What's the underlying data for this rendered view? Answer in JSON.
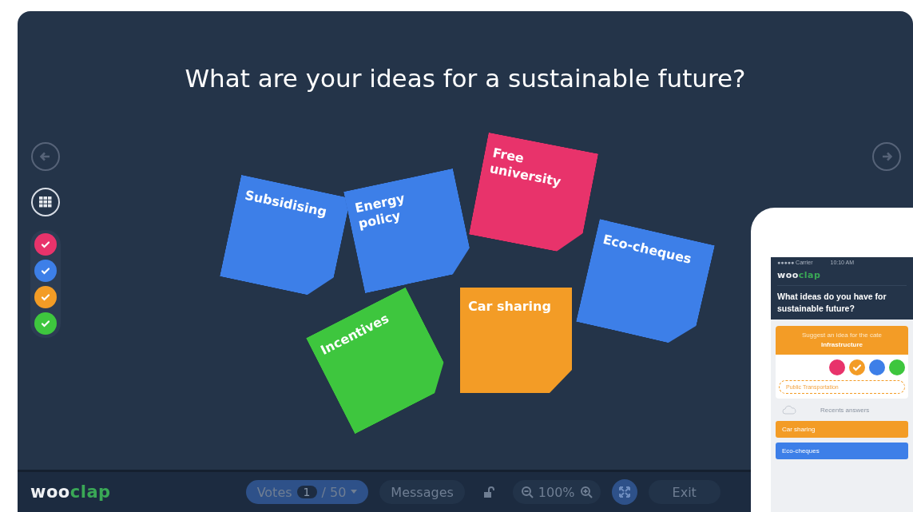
{
  "question": "What are your ideas for a sustainable future?",
  "notes": [
    {
      "text": "Subsidising",
      "color": "#3d7fe8"
    },
    {
      "text": "Energy policy",
      "color": "#3d7fe8"
    },
    {
      "text": "Free university",
      "color": "#e8336b"
    },
    {
      "text": "Eco-cheques",
      "color": "#3d7fe8"
    },
    {
      "text": "Incentives",
      "color": "#3ec63e"
    },
    {
      "text": "Car sharing",
      "color": "#f39c26"
    }
  ],
  "filters": [
    {
      "color": "#e8336b",
      "checked": true
    },
    {
      "color": "#3d7fe8",
      "checked": true
    },
    {
      "color": "#f39c26",
      "checked": true
    },
    {
      "color": "#3ec63e",
      "checked": true
    }
  ],
  "toolbar": {
    "logo": {
      "first": "woo",
      "second": "clap"
    },
    "votes": {
      "label": "Votes",
      "count": "1",
      "total": "/ 50"
    },
    "messages": "Messages",
    "zoom": "100%",
    "exit": "Exit"
  },
  "phone": {
    "carrier": "●●●●● Carrier",
    "time": "10:10 AM",
    "logo": {
      "first": "woo",
      "second": "clap"
    },
    "question_lines": [
      "What ideas do you have for",
      "sustainable future?"
    ],
    "prompt": "Suggest an idea for the cate",
    "category": "Infrastructure",
    "colors": [
      {
        "color": "#e8336b",
        "selected": false
      },
      {
        "color": "#f39c26",
        "selected": true
      },
      {
        "color": "#3d7fe8",
        "selected": false
      },
      {
        "color": "#3ec63e",
        "selected": false
      }
    ],
    "input": "Public Transportation",
    "recent_label": "Recents answers",
    "answers": [
      {
        "text": "Car sharing",
        "color": "#f39c26"
      },
      {
        "text": "Eco-cheques",
        "color": "#3d7fe8"
      }
    ]
  }
}
